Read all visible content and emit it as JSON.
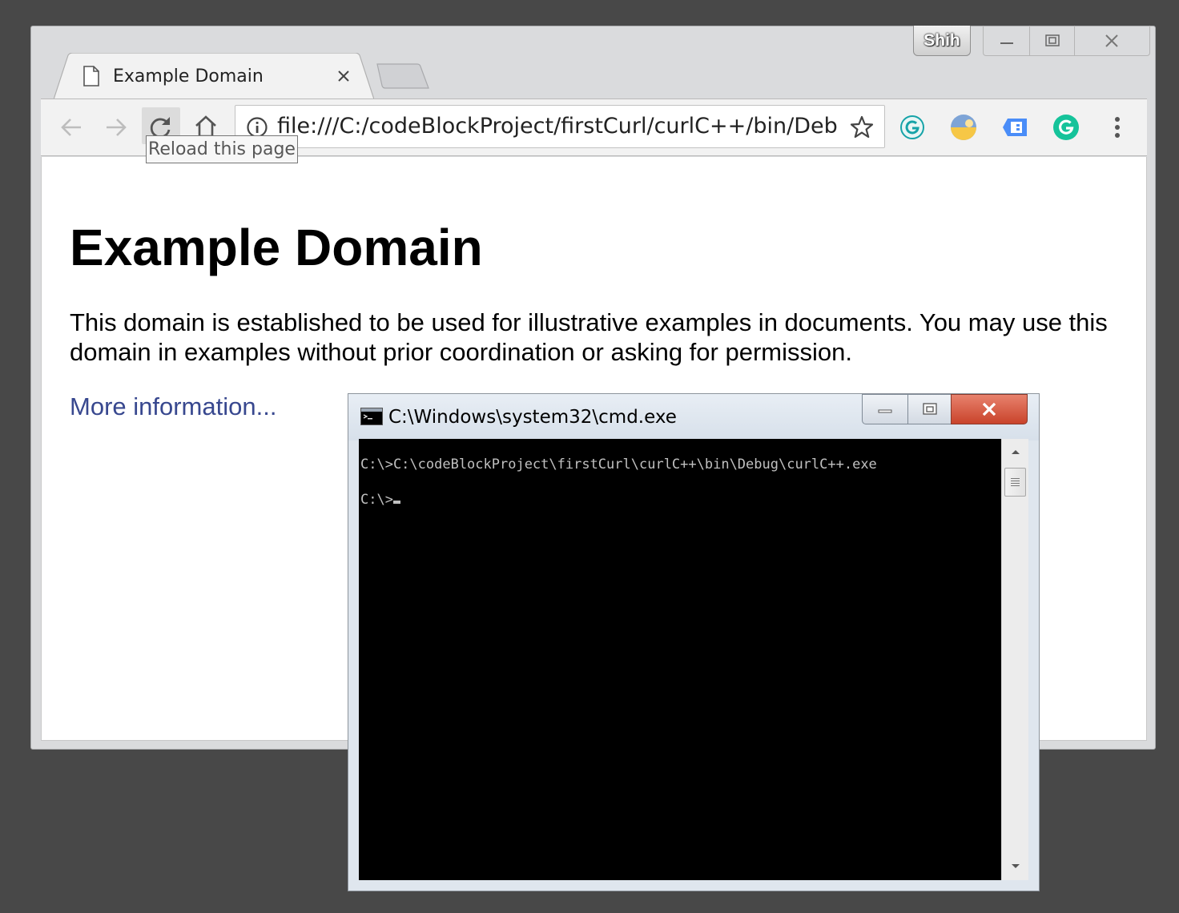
{
  "browser": {
    "profile_name": "Shih",
    "tab": {
      "title": "Example Domain",
      "icon": "page-icon"
    },
    "toolbar": {
      "back_icon": "arrow-left-icon",
      "forward_icon": "arrow-right-icon",
      "reload_icon": "reload-icon",
      "home_icon": "home-icon",
      "url": "file:///C:/codeBlockProject/firstCurl/curlC++/bin/Debug/e",
      "extensions": [
        "grammarly-outline-icon",
        "weather-extension-icon",
        "tab-extension-icon",
        "grammarly-icon"
      ]
    },
    "tooltip": "Reload this page"
  },
  "page": {
    "heading": "Example Domain",
    "paragraph": "This domain is established to be used for illustrative examples in documents. You may use this domain in examples without prior coordination or asking for permission.",
    "link": "More information..."
  },
  "cmd_window": {
    "title": "C:\\Windows\\system32\\cmd.exe",
    "lines": [
      "C:\\>C:\\codeBlockProject\\firstCurl\\curlC++\\bin\\Debug\\curlC++.exe",
      "C:\\>"
    ]
  },
  "colors": {
    "desktop": "#484848",
    "link": "#38488f",
    "close_button": "#c9432b",
    "grammarly_green": "#15c39a"
  }
}
